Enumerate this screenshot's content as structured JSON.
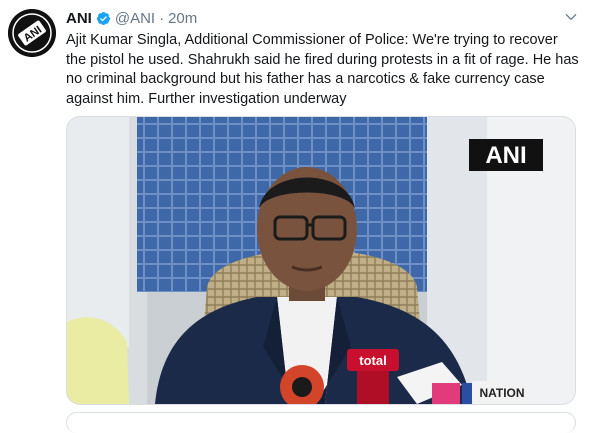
{
  "tweet": {
    "author_name": "ANI",
    "handle": "@ANI",
    "separator": "·",
    "time": "20m",
    "verified": true,
    "avatar_logo_text": "ANI",
    "text": "Ajit Kumar Singla, Additional Commissioner of Police: We're trying to recover the pistol he used. Shahrukh said he fired during protests in a fit of rage. He has no criminal background but his father has a narcotics & fake currency case against him. Further investigation underway",
    "media": {
      "watermark": "ANI",
      "mic_labels": [
        "total",
        "NATION"
      ]
    }
  },
  "colors": {
    "verified_blue": "#1da1f2",
    "secondary_text": "#657786",
    "border": "#d8dee2"
  },
  "icons": {
    "verified": "verified-badge-icon",
    "more": "chevron-down-icon"
  }
}
